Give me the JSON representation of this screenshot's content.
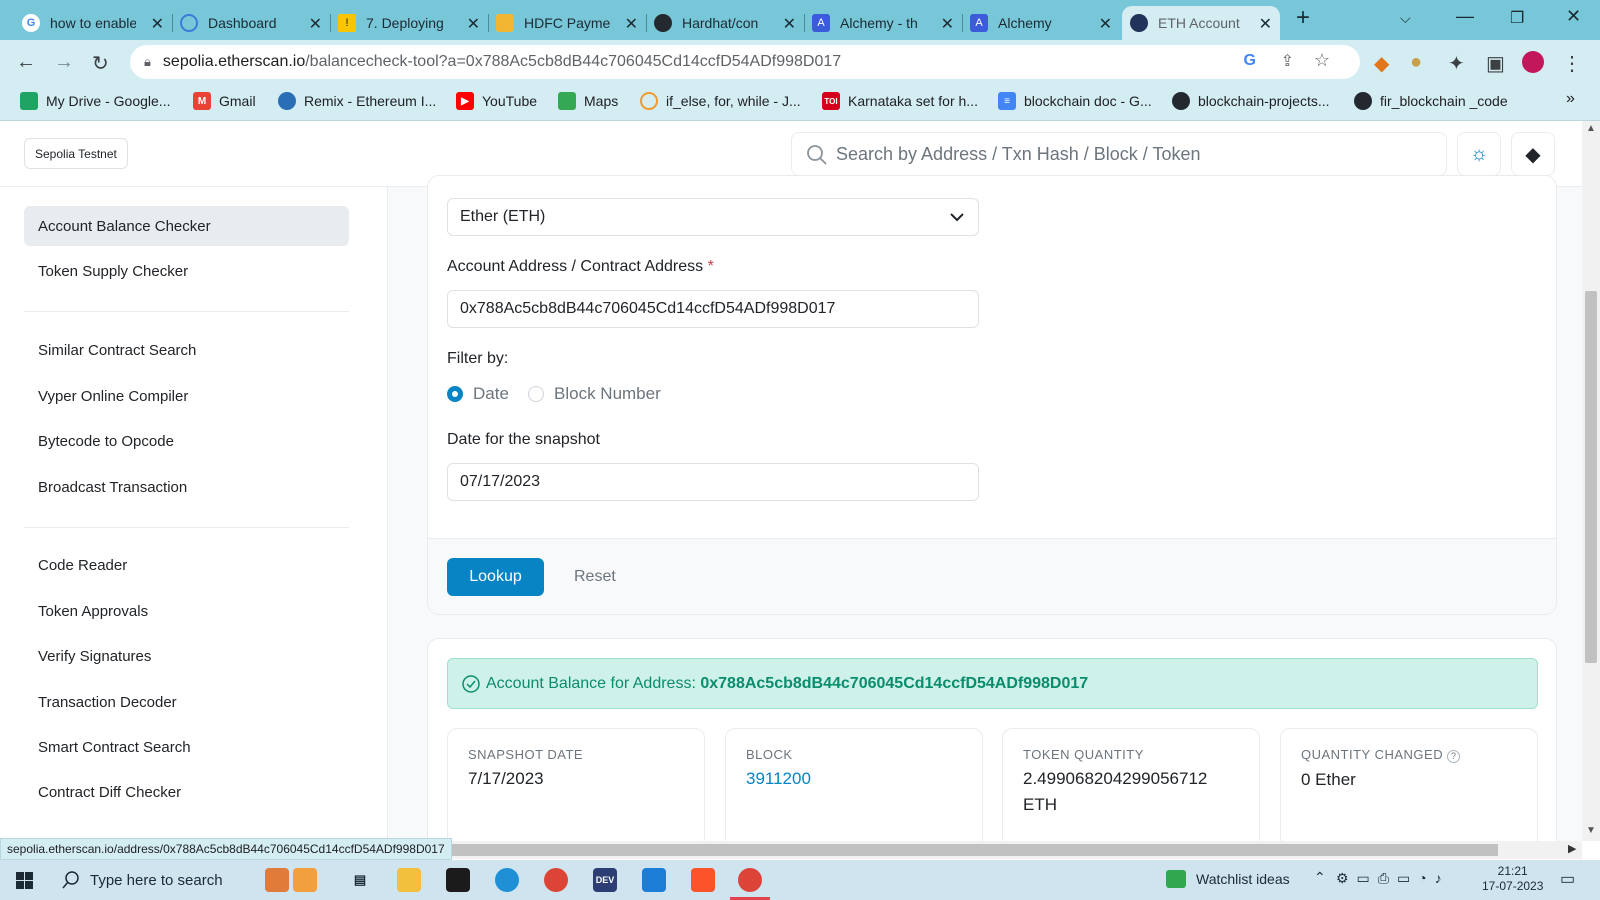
{
  "browser": {
    "tabs": [
      {
        "title": "how to enable",
        "icon": "google-icon",
        "color": "#ffffff"
      },
      {
        "title": "Dashboard",
        "icon": "dashboard-icon",
        "color": "#7cb4f5"
      },
      {
        "title": "7. Deploying",
        "icon": "warning-icon",
        "color": "#f7c600"
      },
      {
        "title": "HDFC Payme",
        "icon": "lock-icon",
        "color": "#f2b632"
      },
      {
        "title": "Hardhat/con",
        "icon": "github-icon",
        "color": "#24292f"
      },
      {
        "title": "Alchemy - th",
        "icon": "alchemy-icon",
        "color": "#3b5bdb"
      },
      {
        "title": "Alchemy",
        "icon": "alchemy-icon",
        "color": "#3b5bdb"
      },
      {
        "title": "ETH Account",
        "icon": "etherscan-icon",
        "color": "#21325b"
      }
    ],
    "url_host": "sepolia.etherscan.io",
    "url_path": "/balancecheck-tool?a=0x788Ac5cb8dB44c706045Cd14ccfD54ADf998D017",
    "bookmarks": [
      {
        "label": "My Drive - Google...",
        "color": "#1fa463"
      },
      {
        "label": "Gmail",
        "color": "#ea4335"
      },
      {
        "label": "Remix - Ethereum I...",
        "color": "#2a6fb5"
      },
      {
        "label": "YouTube",
        "color": "#ff0000"
      },
      {
        "label": "Maps",
        "color": "#34a853"
      },
      {
        "label": "if_else, for, while - J...",
        "color": "#f29a2e"
      },
      {
        "label": "Karnataka set for h...",
        "color": "#d6001c"
      },
      {
        "label": "blockchain doc - G...",
        "color": "#4285f4"
      },
      {
        "label": "blockchain-projects...",
        "color": "#24292f"
      },
      {
        "label": "fir_blockchain _code",
        "color": "#24292f"
      }
    ]
  },
  "site": {
    "network_badge": "Sepolia Testnet",
    "search_placeholder": "Search by Address / Txn Hash / Block / Token"
  },
  "sidebar": {
    "items": [
      "Account Balance Checker",
      "Token Supply Checker",
      "Similar Contract Search",
      "Vyper Online Compiler",
      "Bytecode to Opcode",
      "Broadcast Transaction",
      "Code Reader",
      "Token Approvals",
      "Verify Signatures",
      "Transaction Decoder",
      "Smart Contract Search",
      "Contract Diff Checker"
    ]
  },
  "form": {
    "token_select": "Ether (ETH)",
    "address_label": "Account Address / Contract Address",
    "required_mark": "*",
    "address_value": "0x788Ac5cb8dB44c706045Cd14ccfD54ADf998D017",
    "filter_label": "Filter by:",
    "filter_option_date": "Date",
    "filter_option_block": "Block Number",
    "date_label": "Date for the snapshot",
    "date_value": "07/17/2023",
    "lookup_label": "Lookup",
    "reset_label": "Reset"
  },
  "result": {
    "alert_prefix": "Account Balance for Address:",
    "alert_address": "0x788Ac5cb8dB44c706045Cd14ccfD54ADf998D017",
    "snapshot_label": "SNAPSHOT DATE",
    "snapshot_value": "7/17/2023",
    "block_label": "BLOCK",
    "block_value": "3911200",
    "quantity_label": "TOKEN QUANTITY",
    "quantity_value": "2.499068204299056712 ETH",
    "changed_label": "QUANTITY CHANGED",
    "changed_value": "0 Ether"
  },
  "status_url": "sepolia.etherscan.io/address/0x788Ac5cb8dB44c706045Cd14ccfD54ADf998D017",
  "taskbar": {
    "search_placeholder": "Type here to search",
    "watchlist": "Watchlist ideas",
    "time": "21:21",
    "date": "17-07-2023"
  }
}
